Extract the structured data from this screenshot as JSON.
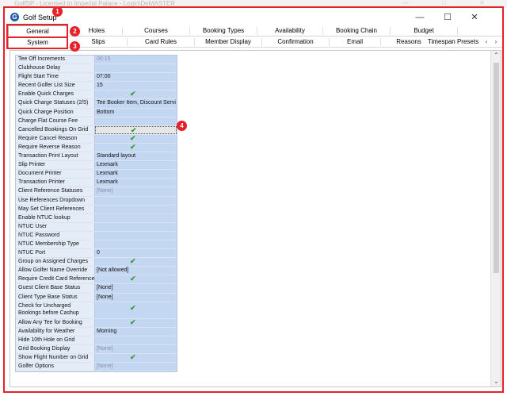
{
  "background": {
    "faded_title": "GolfSP - Licensed to Imperial Palace - Login\\DeMASTER",
    "faded_controls": "— □ ✕"
  },
  "window": {
    "title": "Golf Setup",
    "app_icon": "golf-icon",
    "minimize": "—",
    "maximize": "☐",
    "close": "✕"
  },
  "tabs_row1": [
    "General",
    "Holes",
    "Courses",
    "Booking Types",
    "Availability",
    "Booking Chain",
    "Budget"
  ],
  "tabs_row2": [
    "System",
    "Slips",
    "Card Rules",
    "Member Display",
    "Confirmation",
    "Email",
    "Reasons",
    "Timespan Presets"
  ],
  "tab_scroll": {
    "left": "‹",
    "right": "›"
  },
  "annotations": [
    "1",
    "2",
    "3",
    "4"
  ],
  "check_glyph": "✔",
  "scrollbar": {
    "up": "⌃",
    "down": "⌄"
  },
  "settings": [
    {
      "label": "Tee Off Increments",
      "value": "00:15",
      "grey": true
    },
    {
      "label": "Clubhouse Delay",
      "value": ""
    },
    {
      "label": "Flight Start Time",
      "value": "07:00"
    },
    {
      "label": "Recent Golfer List Size",
      "value": "15"
    },
    {
      "label": "Enable Quick Charges",
      "check": true
    },
    {
      "label": "Quick Charge Statuses (2/5)",
      "value": "Tee Booker Item, Discount Servi"
    },
    {
      "label": "Quick Charge Position",
      "value": "Bottom"
    },
    {
      "label": "Charge Flat Course Fee",
      "value": ""
    },
    {
      "label": "Cancelled Bookings On Grid",
      "check": true,
      "focus": true
    },
    {
      "label": "Require Cancel Reason",
      "check": true
    },
    {
      "label": "Require Reverse Reason",
      "check": true
    },
    {
      "label": "Transaction Print Layout",
      "value": "Standard layout"
    },
    {
      "label": "Slip Printer",
      "value": "Lexmark"
    },
    {
      "label": "Document Printer",
      "value": "Lexmark"
    },
    {
      "label": "Transaction Printer",
      "value": "Lexmark"
    },
    {
      "label": "Client Reference Statuses",
      "value": "[None]",
      "grey": true
    },
    {
      "label": "Use References Dropdown",
      "value": ""
    },
    {
      "label": "May Set Client References",
      "value": ""
    },
    {
      "label": "Enable NTUC lookup",
      "value": ""
    },
    {
      "label": "NTUC User",
      "value": ""
    },
    {
      "label": "NTUC Password",
      "value": ""
    },
    {
      "label": "NTUC Membership Type",
      "value": ""
    },
    {
      "label": "NTUC Port",
      "value": "0"
    },
    {
      "label": "Group on Assigned Charges",
      "check": true
    },
    {
      "label": "Allow Golfer Name Override",
      "value": "[Not allowed]"
    },
    {
      "label": "Require Credit Card Reference",
      "check": true
    },
    {
      "label": "Guest Client Base Status",
      "value": "[None]"
    },
    {
      "label": "Client Type Base Status",
      "value": "[None]"
    },
    {
      "label": "Check for Uncharged Bookings before Cashup",
      "check": true,
      "tall": true
    },
    {
      "label": "Allow Any Tee for Booking",
      "check": true
    },
    {
      "label": "Availability for Weather",
      "value": "Morning"
    },
    {
      "label": "Hide 10th Hole on Grid",
      "value": ""
    },
    {
      "label": "Grid Booking Display",
      "value": "[None]",
      "grey": true
    },
    {
      "label": "Show Flight Number on Grid",
      "check": true
    },
    {
      "label": "Golfer Options",
      "value": "[None]",
      "grey": true
    }
  ],
  "colors": {
    "annotation": "#e8202a",
    "label_bg": "#e4ecf7",
    "value_bg": "#c4d7f2",
    "check": "#3a9a3a"
  }
}
